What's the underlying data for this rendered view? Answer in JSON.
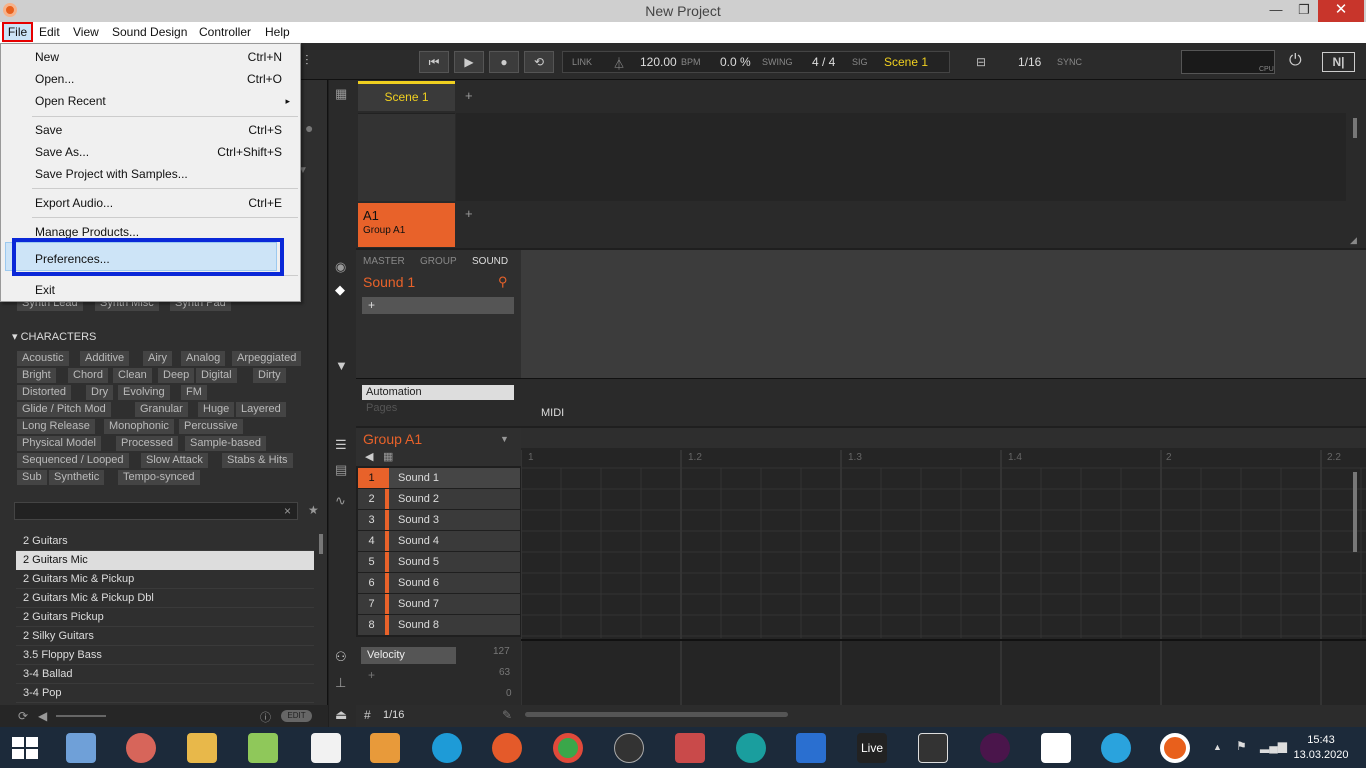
{
  "window": {
    "title": "New Project",
    "min": "—",
    "max": "❐",
    "close": "✕"
  },
  "menubar": [
    "File",
    "Edit",
    "View",
    "Sound Design",
    "Controller",
    "Help"
  ],
  "file_menu": {
    "items": [
      {
        "label": "New",
        "shortcut": "Ctrl+N"
      },
      {
        "label": "Open...",
        "shortcut": "Ctrl+O"
      },
      {
        "label": "Open Recent",
        "shortcut": "▸"
      },
      {
        "label": "Save",
        "shortcut": "Ctrl+S"
      },
      {
        "label": "Save As...",
        "shortcut": "Ctrl+Shift+S"
      },
      {
        "label": "Save Project with Samples...",
        "shortcut": ""
      },
      {
        "label": "Export Audio...",
        "shortcut": "Ctrl+E"
      },
      {
        "label": "Manage Products...",
        "shortcut": ""
      },
      {
        "label": "Preferences...",
        "shortcut": ""
      },
      {
        "label": "Exit",
        "shortcut": ""
      }
    ]
  },
  "transport": {
    "link": "LINK",
    "bpm": "120.00",
    "bpm_label": "BPM",
    "swing": "0.0 %",
    "swing_label": "SWING",
    "sig": "4 / 4",
    "sig_label": "SIG",
    "scene": "Scene 1",
    "grid": "1/16",
    "sync": "SYNC",
    "cpu": "CPU"
  },
  "browser": {
    "partial_tags": [
      "Synth Lead",
      "Synth Misc",
      "Synth Pad"
    ],
    "characters_header": "CHARACTERS",
    "tags": [
      "Acoustic",
      "Additive",
      "Airy",
      "Analog",
      "Arpeggiated",
      "Bright",
      "Chord",
      "Clean",
      "Deep",
      "Digital",
      "Dirty",
      "Distorted",
      "Dry",
      "Evolving",
      "FM",
      "Glide / Pitch Mod",
      "Granular",
      "Huge",
      "Layered",
      "Long Release",
      "Monophonic",
      "Percussive",
      "Physical Model",
      "Processed",
      "Sample-based",
      "Sequenced / Looped",
      "Slow Attack",
      "Stabs & Hits",
      "Sub",
      "Synthetic",
      "Tempo-synced"
    ],
    "results": [
      "2 Guitars",
      "2 Guitars Mic",
      "2 Guitars Mic & Pickup",
      "2 Guitars Mic & Pickup Dbl",
      "2 Guitars Pickup",
      "2 Silky Guitars",
      "3.5 Floppy Bass",
      "3-4 Ballad",
      "3-4 Pop"
    ],
    "selected_result": "2 Guitars Mic",
    "clear": "×",
    "star": "★",
    "edit": "EDIT"
  },
  "arranger": {
    "scene": "Scene 1",
    "plus": "+",
    "group_id": "A1",
    "group_name": "Group A1"
  },
  "control": {
    "tabs": [
      "MASTER",
      "GROUP",
      "SOUND"
    ],
    "sound_name": "Sound 1",
    "automation": "Automation",
    "pages": "Pages",
    "midi": "MIDI"
  },
  "pattern": {
    "group": "Group A1",
    "sounds": [
      "Sound 1",
      "Sound 2",
      "Sound 3",
      "Sound 4",
      "Sound 5",
      "Sound 6",
      "Sound 7",
      "Sound 8"
    ],
    "ruler": [
      "1",
      "1.2",
      "1.3",
      "1.4",
      "2",
      "2.2"
    ],
    "velocity": "Velocity",
    "vel_max": "127",
    "vel_mid": "63",
    "vel_min": "0",
    "grid": "1/16",
    "hash": "#"
  },
  "clock": {
    "time": "15:43",
    "date": "13.03.2020"
  },
  "taskbar": {
    "live": "Live"
  }
}
